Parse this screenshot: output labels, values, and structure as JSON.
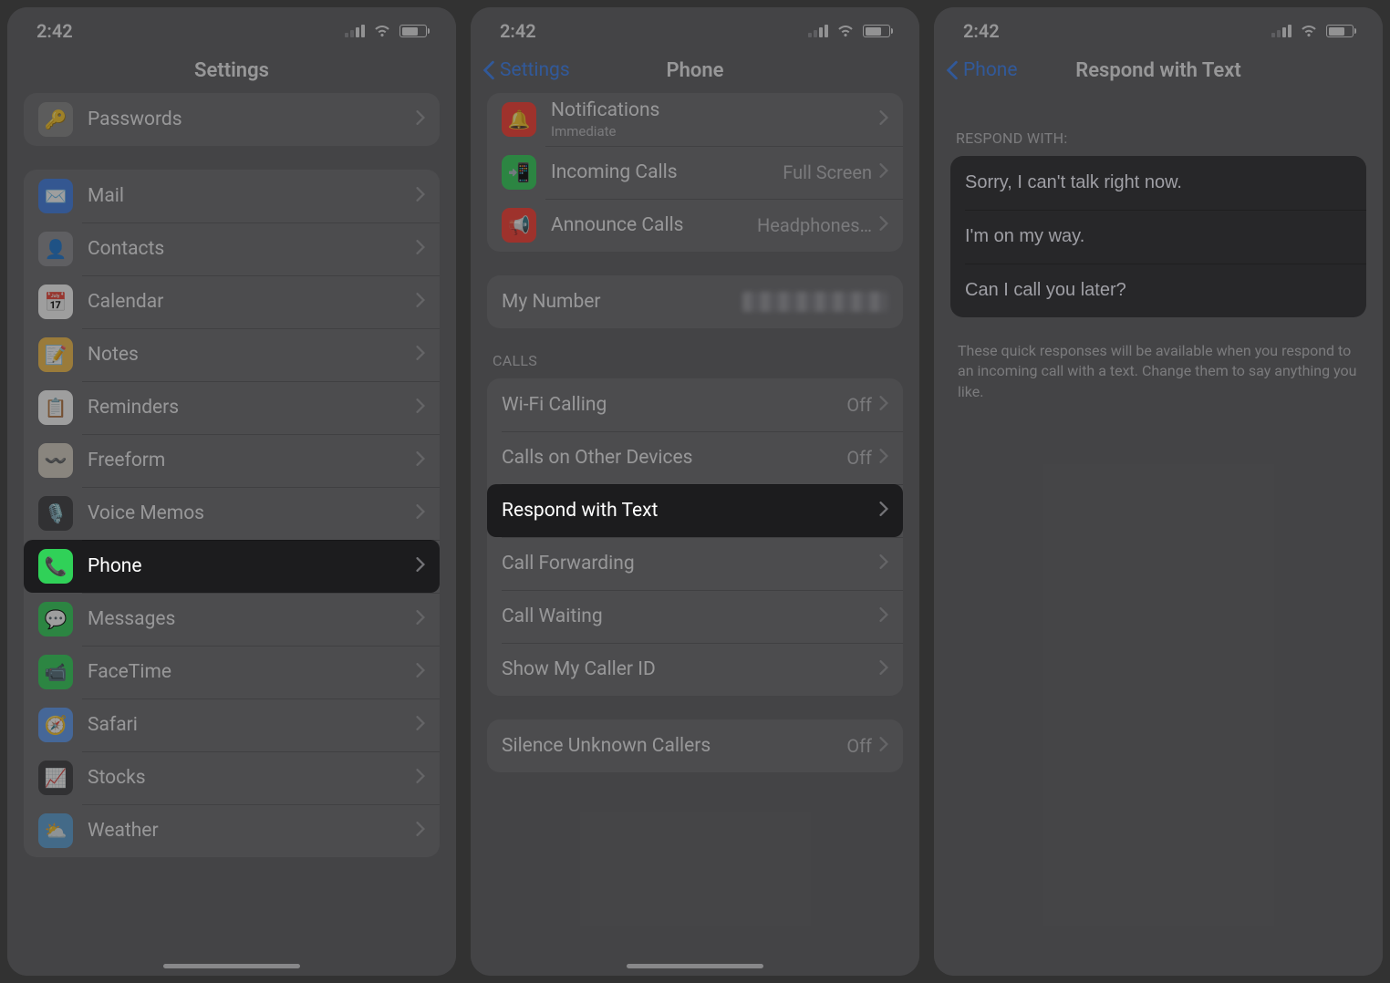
{
  "status": {
    "time": "2:42"
  },
  "screen1": {
    "title": "Settings",
    "items": [
      {
        "label": "Passwords",
        "icon": "key-icon"
      },
      {
        "label": "Mail",
        "icon": "mail-icon"
      },
      {
        "label": "Contacts",
        "icon": "contacts-icon"
      },
      {
        "label": "Calendar",
        "icon": "calendar-icon"
      },
      {
        "label": "Notes",
        "icon": "notes-icon"
      },
      {
        "label": "Reminders",
        "icon": "reminders-icon"
      },
      {
        "label": "Freeform",
        "icon": "freeform-icon"
      },
      {
        "label": "Voice Memos",
        "icon": "voice-memos-icon"
      },
      {
        "label": "Phone",
        "icon": "phone-icon",
        "highlighted": true
      },
      {
        "label": "Messages",
        "icon": "messages-icon"
      },
      {
        "label": "FaceTime",
        "icon": "facetime-icon"
      },
      {
        "label": "Safari",
        "icon": "safari-icon"
      },
      {
        "label": "Stocks",
        "icon": "stocks-icon"
      },
      {
        "label": "Weather",
        "icon": "weather-icon"
      }
    ]
  },
  "screen2": {
    "back": "Settings",
    "title": "Phone",
    "group1": [
      {
        "label": "Notifications",
        "sub": "Immediate",
        "icon": "bell-icon"
      },
      {
        "label": "Incoming Calls",
        "value": "Full Screen",
        "icon": "incoming-icon"
      },
      {
        "label": "Announce Calls",
        "value": "Headphones…",
        "icon": "announce-icon"
      }
    ],
    "myNumberLabel": "My Number",
    "callsHeader": "CALLS",
    "callsItems": [
      {
        "label": "Wi-Fi Calling",
        "value": "Off"
      },
      {
        "label": "Calls on Other Devices",
        "value": "Off"
      },
      {
        "label": "Respond with Text",
        "highlighted": true
      },
      {
        "label": "Call Forwarding"
      },
      {
        "label": "Call Waiting"
      },
      {
        "label": "Show My Caller ID"
      }
    ],
    "silenceGroup": [
      {
        "label": "Silence Unknown Callers",
        "value": "Off"
      }
    ]
  },
  "screen3": {
    "back": "Phone",
    "title": "Respond with Text",
    "header": "RESPOND WITH:",
    "responses": [
      "Sorry, I can't talk right now.",
      "I'm on my way.",
      "Can I call you later?"
    ],
    "footer": "These quick responses will be available when you respond to an incoming call with a text. Change them to say anything you like."
  }
}
